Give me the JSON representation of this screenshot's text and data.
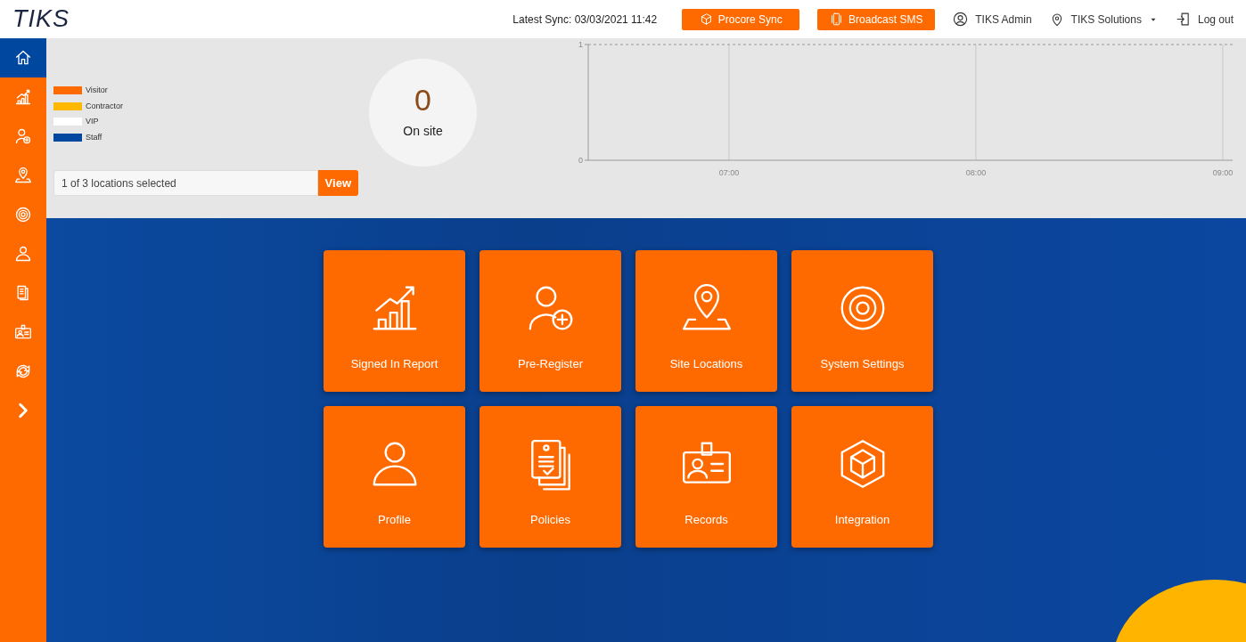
{
  "header": {
    "logo": "TIKS",
    "latest_sync": "Latest Sync: 03/03/2021 11:42",
    "buttons": [
      "Procore Sync",
      "Broadcast SMS"
    ],
    "user": "TIKS Admin",
    "company": "TIKS Solutions",
    "logout": "Log out"
  },
  "sidebar": {
    "items": [
      {
        "selected": true
      },
      {
        "selected": false
      },
      {
        "selected": false
      },
      {
        "selected": false
      },
      {
        "selected": false
      },
      {
        "selected": false
      },
      {
        "selected": false
      },
      {
        "selected": false
      },
      {
        "selected": false
      },
      {
        "selected": false
      }
    ]
  },
  "legend": [
    {
      "label": "Visitor",
      "color": "#ff6a00"
    },
    {
      "label": "Contractor",
      "color": "#ffb800"
    },
    {
      "label": "VIP",
      "color": "#ffffff"
    },
    {
      "label": "Staff",
      "color": "#0047a0"
    }
  ],
  "on_site": {
    "count": "0",
    "label": "On site"
  },
  "location_filter": {
    "value": "1 of 3 locations selected",
    "button": "View"
  },
  "chart": {
    "chart_data": {
      "type": "line",
      "grid": true,
      "xlim": [
        6.43,
        9.04
      ],
      "ylim": [
        0,
        1
      ],
      "xticks": [
        {
          "value": 7,
          "label": "07:00"
        },
        {
          "value": 8,
          "label": "08:00"
        },
        {
          "value": 9,
          "label": "09:00"
        }
      ],
      "yticks": [
        0,
        1
      ]
    }
  },
  "tiles": [
    {
      "label": "Signed In Report"
    },
    {
      "label": "Pre-Register"
    },
    {
      "label": "Site Locations"
    },
    {
      "label": "System Settings"
    },
    {
      "label": "Profile"
    },
    {
      "label": "Policies"
    },
    {
      "label": "Records"
    },
    {
      "label": "Integration"
    }
  ]
}
